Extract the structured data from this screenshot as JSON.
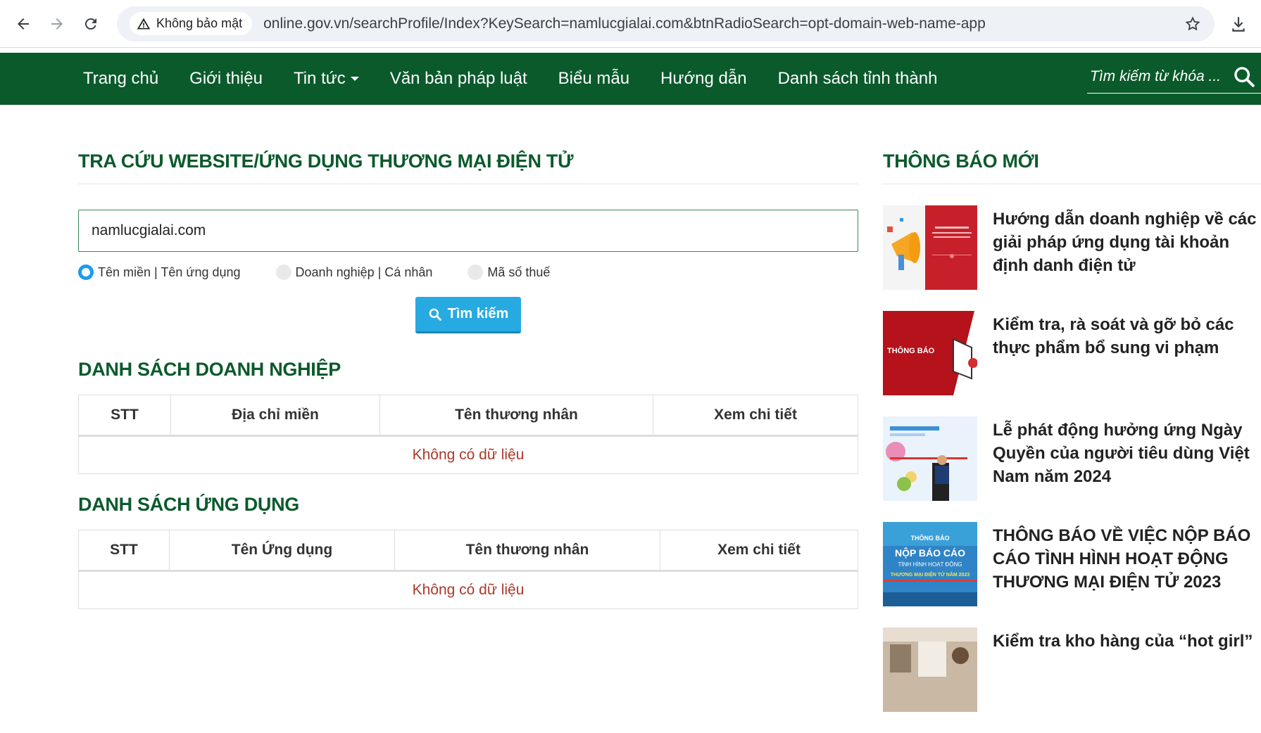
{
  "browser": {
    "security_label": "Không bảo mật",
    "url": "online.gov.vn/searchProfile/Index?KeySearch=namlucgialai.com&btnRadioSearch=opt-domain-web-name-app"
  },
  "nav": {
    "items": [
      {
        "label": "Trang chủ"
      },
      {
        "label": "Giới thiệu"
      },
      {
        "label": "Tin tức"
      },
      {
        "label": "Văn bản pháp luật"
      },
      {
        "label": "Biểu mẫu"
      },
      {
        "label": "Hướng dẫn"
      },
      {
        "label": "Danh sách tỉnh thành"
      }
    ],
    "search_placeholder": "Tìm kiếm từ khóa ..."
  },
  "main": {
    "title": "TRA CỨU WEBSITE/ỨNG DỤNG THƯƠNG MẠI ĐIỆN TỬ",
    "search_value": "namlucgialai.com",
    "radios": [
      {
        "label": "Tên miền | Tên ứng dụng",
        "checked": true
      },
      {
        "label": "Doanh nghiệp | Cá nhân",
        "checked": false
      },
      {
        "label": "Mã số thuế",
        "checked": false
      }
    ],
    "search_button": "Tìm kiếm",
    "businesses": {
      "title": "DANH SÁCH DOANH NGHIỆP",
      "columns": [
        "STT",
        "Địa chỉ miền",
        "Tên thương nhân",
        "Xem chi tiết"
      ],
      "empty": "Không có dữ liệu"
    },
    "apps": {
      "title": "DANH SÁCH ỨNG DỤNG",
      "columns": [
        "STT",
        "Tên Ứng dụng",
        "Tên thương nhân",
        "Xem chi tiết"
      ],
      "empty": "Không có dữ liệu"
    }
  },
  "sidebar": {
    "title": "THÔNG BÁO MỚI",
    "news": [
      {
        "title": "Hướng dẫn doanh nghiệp về các giải pháp ứng dụng tài khoản định danh điện tử"
      },
      {
        "title": "Kiểm tra, rà soát và gỡ bỏ các thực phẩm bổ sung vi phạm",
        "thumb_text": "THÔNG BÁO"
      },
      {
        "title": "Lễ phát động hưởng ứng Ngày Quyền của người tiêu dùng Việt Nam năm 2024"
      },
      {
        "title": "THÔNG BÁO VỀ VIỆC NỘP BÁO CÁO TÌNH HÌNH HOẠT ĐỘNG THƯƠNG MẠI ĐIỆN TỬ 2023",
        "thumb_lines": [
          "THÔNG BÁO",
          "NỘP BÁO CÁO",
          "TÌNH HÌNH HOẠT ĐỘNG",
          "THƯƠNG MẠI ĐIỆN TỬ NĂM 2023"
        ]
      },
      {
        "title": "Kiểm tra kho hàng của “hot girl”"
      }
    ]
  },
  "colors": {
    "nav_bg": "#0b5a2c",
    "title_green": "#0b5a2c",
    "button_blue": "#27aae1",
    "empty_red": "#a83a2a"
  }
}
